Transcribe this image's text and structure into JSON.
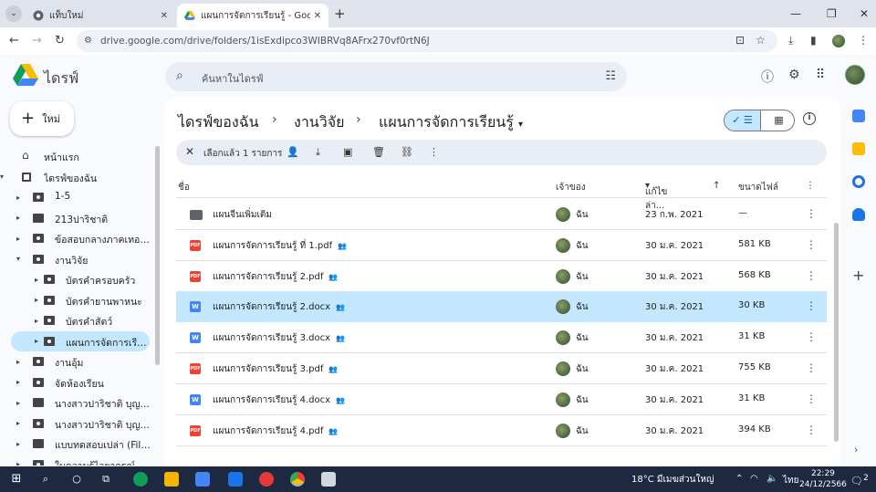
{
  "browser": {
    "tabs": [
      {
        "title": "แท็บใหม่",
        "active": false
      },
      {
        "title": "แผนการจัดการเรียนรู้ - Google ไดรฟ์",
        "active": true
      }
    ],
    "url": "drive.google.com/drive/folders/1isExdipco3WIBRVq8AFrx270vf0rtN6J"
  },
  "drive": {
    "app_name": "ไดรฟ์",
    "search_placeholder": "ค้นหาในไดรฟ์",
    "new_label": "ใหม่",
    "sidebar": [
      {
        "label": "หน้าแรก",
        "indent": 0,
        "caret": "",
        "icon": "home"
      },
      {
        "label": "ไดรฟ์ของฉัน",
        "indent": 0,
        "caret": "down",
        "icon": "drive"
      },
      {
        "label": "1-5",
        "indent": 1,
        "caret": "right",
        "icon": "shared-folder"
      },
      {
        "label": "213ปาริชาติ",
        "indent": 1,
        "caret": "right",
        "icon": "folder"
      },
      {
        "label": "ข้อสอบกลางภาคเทอม2",
        "indent": 1,
        "caret": "right",
        "icon": "shared-folder"
      },
      {
        "label": "งานวิจัย",
        "indent": 1,
        "caret": "down",
        "icon": "shared-folder"
      },
      {
        "label": "บัตรคำครอบครัว",
        "indent": 2,
        "caret": "right",
        "icon": "shared-folder"
      },
      {
        "label": "บัตรคำยานพาหนะ",
        "indent": 2,
        "caret": "right",
        "icon": "shared-folder"
      },
      {
        "label": "บัตรคำสัตว์",
        "indent": 2,
        "caret": "right",
        "icon": "shared-folder"
      },
      {
        "label": "แผนการจัดการเรียนรู้",
        "indent": 2,
        "caret": "right",
        "icon": "shared-folder",
        "selected": true
      },
      {
        "label": "งานอุ้ม",
        "indent": 1,
        "caret": "right",
        "icon": "shared-folder"
      },
      {
        "label": "จัดห้องเรียน",
        "indent": 1,
        "caret": "right",
        "icon": "shared-folder"
      },
      {
        "label": "นางสาวปาริชาติ บุญยศ ...",
        "indent": 1,
        "caret": "right",
        "icon": "folder"
      },
      {
        "label": "นางสาวปาริชาติ บุญยศ ...",
        "indent": 1,
        "caret": "right",
        "icon": "shared-folder"
      },
      {
        "label": "แบบทดสอบเปล่า (File ...",
        "indent": 1,
        "caret": "right",
        "icon": "folder"
      },
      {
        "label": "ใบความรู้ไวยากรณ์",
        "indent": 1,
        "caret": "right",
        "icon": "shared-folder"
      }
    ],
    "breadcrumb": [
      "ไดรฟ์ของฉัน",
      "งานวิจัย",
      "แผนการจัดการเรียนรู้"
    ],
    "selection_text": "เลือกแล้ว 1 รายการ",
    "columns": {
      "name": "ชื่อ",
      "owner": "เจ้าของ",
      "modified": "แก้ไขล่า...",
      "size": "ขนาดไฟล์"
    },
    "files": [
      {
        "name": "แผนจีนเพิ่มเติม",
        "type": "folder",
        "shared": false,
        "owner": "ฉัน",
        "modified": "23 ก.พ. 2021",
        "size": "—"
      },
      {
        "name": "แผนการจัดการเรียนรู้ ที่ 1.pdf",
        "type": "pdf",
        "shared": true,
        "owner": "ฉัน",
        "modified": "30 ม.ค. 2021",
        "size": "581 KB"
      },
      {
        "name": "แผนการจัดการเรียนรู้ 2.pdf",
        "type": "pdf",
        "shared": true,
        "owner": "ฉัน",
        "modified": "30 ม.ค. 2021",
        "size": "568 KB"
      },
      {
        "name": "แผนการจัดการเรียนรู้ 2.docx",
        "type": "doc",
        "shared": true,
        "owner": "ฉัน",
        "modified": "30 ม.ค. 2021",
        "size": "30 KB",
        "selected": true
      },
      {
        "name": "แผนการจัดการเรียนรู้ 3.docx",
        "type": "doc",
        "shared": true,
        "owner": "ฉัน",
        "modified": "30 ม.ค. 2021",
        "size": "31 KB"
      },
      {
        "name": "แผนการจัดการเรียนรู้ 3.pdf",
        "type": "pdf",
        "shared": true,
        "owner": "ฉัน",
        "modified": "30 ม.ค. 2021",
        "size": "755 KB"
      },
      {
        "name": "แผนการจัดการเรียนรู้ 4.docx",
        "type": "doc",
        "shared": true,
        "owner": "ฉัน",
        "modified": "30 ม.ค. 2021",
        "size": "31 KB"
      },
      {
        "name": "แผนการจัดการเรียนรู้ 4.pdf",
        "type": "pdf",
        "shared": true,
        "owner": "ฉัน",
        "modified": "30 ม.ค. 2021",
        "size": "394 KB"
      }
    ]
  },
  "taskbar": {
    "weather": "18°C  มีเมฆส่วนใหญ่",
    "language": "ไทย",
    "time": "22:29",
    "date": "24/12/2566",
    "notifications": "2"
  },
  "colors": {
    "selected": "#c2e7ff",
    "accent": "#0b57d0",
    "pdf": "#ea4335",
    "doc": "#4285f4"
  }
}
